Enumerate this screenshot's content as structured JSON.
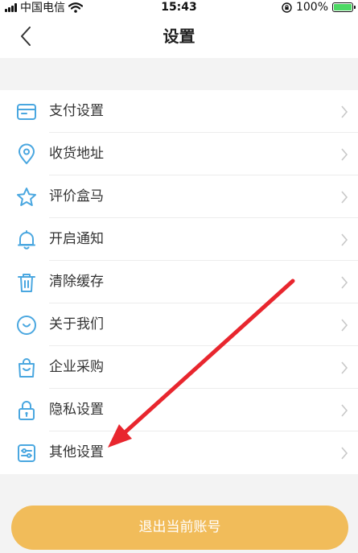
{
  "status_bar": {
    "carrier": "中国电信",
    "time": "15:43",
    "battery": "100%"
  },
  "nav": {
    "title": "设置"
  },
  "settings": {
    "items": [
      {
        "label": "支付设置",
        "icon": "card-icon"
      },
      {
        "label": "收货地址",
        "icon": "location-pin-icon"
      },
      {
        "label": "评价盒马",
        "icon": "star-icon"
      },
      {
        "label": "开启通知",
        "icon": "bell-icon"
      },
      {
        "label": "清除缓存",
        "icon": "trash-icon"
      },
      {
        "label": "关于我们",
        "icon": "smile-circle-icon"
      },
      {
        "label": "企业采购",
        "icon": "shopping-bag-icon"
      },
      {
        "label": "隐私设置",
        "icon": "lock-icon"
      },
      {
        "label": "其他设置",
        "icon": "sliders-icon"
      }
    ]
  },
  "logout_label": "退出当前账号",
  "colors": {
    "icon": "#4aa7e0",
    "accent": "#f1bc5a",
    "annotation_arrow": "#e8262e"
  }
}
